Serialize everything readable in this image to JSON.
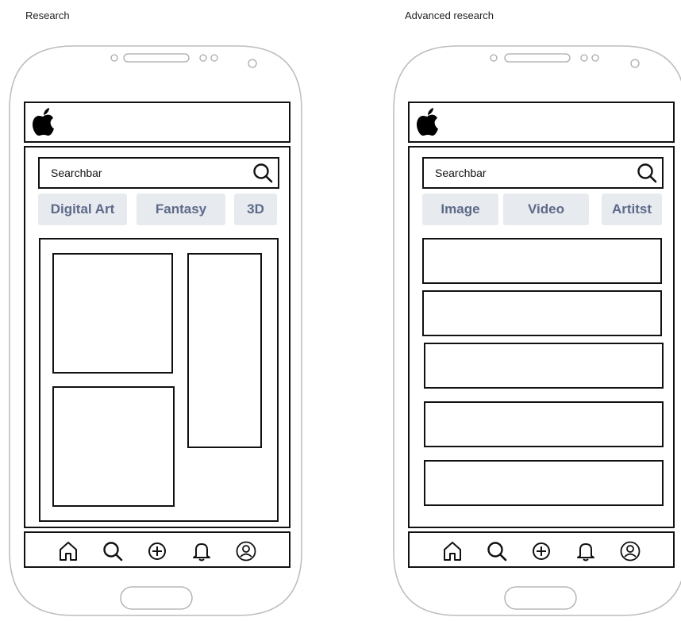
{
  "diagram_title_left": "Research",
  "diagram_title_right": "Advanced research",
  "screens": [
    {
      "caption": "Research",
      "search_placeholder": "Searchbar",
      "chips": [
        "Digital Art",
        "Fantasy",
        "3D"
      ],
      "content_layout": "masonry-grid",
      "nav_icons": [
        "home-icon",
        "search-icon",
        "add-icon",
        "bell-icon",
        "profile-icon"
      ]
    },
    {
      "caption": "Advanced research",
      "search_placeholder": "Searchbar",
      "chips": [
        "Image",
        "Video",
        "Artitst"
      ],
      "content_layout": "list",
      "nav_icons": [
        "home-icon",
        "search-icon",
        "add-icon",
        "bell-icon",
        "profile-icon"
      ]
    }
  ]
}
